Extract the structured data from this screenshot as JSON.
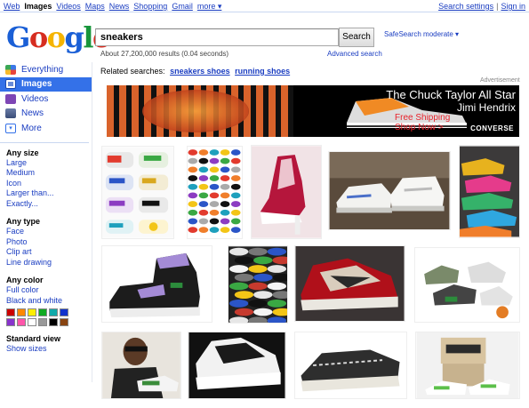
{
  "topnav": {
    "items": [
      "Web",
      "Images",
      "Videos",
      "Maps",
      "News",
      "Shopping",
      "Gmail",
      "more ▾"
    ],
    "current": "Images"
  },
  "topright": {
    "settings": "Search settings",
    "separator": "|",
    "signin": "Sign in"
  },
  "search": {
    "value": "sneakers",
    "button": "Search",
    "safesearch": "SafeSearch moderate ▾",
    "results_count": "About 27,200,000 results (0.04 seconds)",
    "advanced": "Advanced search"
  },
  "sidebar": {
    "nav": [
      {
        "label": "Everything",
        "icon": "everything-icon"
      },
      {
        "label": "Images",
        "icon": "images-icon",
        "active": true
      },
      {
        "label": "Videos",
        "icon": "videos-icon"
      },
      {
        "label": "News",
        "icon": "news-icon"
      },
      {
        "label": "More",
        "icon": "more-icon"
      }
    ],
    "size": {
      "heading": "Any size",
      "options": [
        "Large",
        "Medium",
        "Icon",
        "Larger than...",
        "Exactly..."
      ]
    },
    "type": {
      "heading": "Any type",
      "options": [
        "Face",
        "Photo",
        "Clip art",
        "Line drawing"
      ]
    },
    "color": {
      "heading": "Any color",
      "options": [
        "Full color",
        "Black and white"
      ],
      "swatches": [
        "#cc0000",
        "#ff8800",
        "#ffee00",
        "#11aa22",
        "#11aaaa",
        "#1133cc",
        "#8833cc",
        "#ff55aa",
        "#ffffff",
        "#999999",
        "#000000",
        "#884411"
      ]
    },
    "view": {
      "heading": "Standard view",
      "options": [
        "Show sizes"
      ]
    }
  },
  "related": {
    "label": "Related searches:",
    "links": [
      "sneakers shoes",
      "running shoes"
    ]
  },
  "ad": {
    "label": "Advertisement",
    "line1": "The Chuck Taylor All Star",
    "line2": "Jimi Hendrix",
    "line3": "Free Shipping",
    "line4": "Shop Now >",
    "brand": "CONVERSE"
  },
  "colors": {
    "link": "#1a3dc1",
    "active_nav": "#3471e8"
  }
}
